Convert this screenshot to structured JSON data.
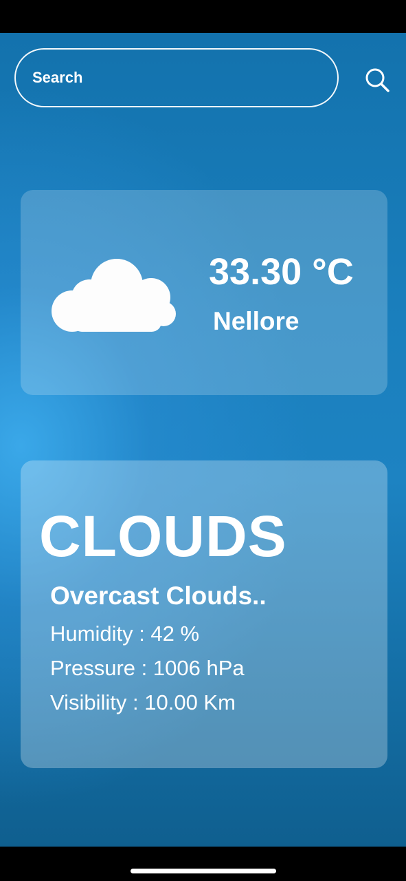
{
  "search": {
    "placeholder": "Search",
    "icon": "search-icon"
  },
  "current": {
    "icon": "cloud-icon",
    "temperature": "33.30 °C",
    "city": "Nellore"
  },
  "details": {
    "condition": "CLOUDS",
    "description": "Overcast Clouds..",
    "humidity": "Humidity : 42 %",
    "pressure": "Pressure : 1006 hPa",
    "visibility": "Visibility : 10.00 Km"
  },
  "colors": {
    "background_top": "#1372ad",
    "background_mid": "#1d83c2",
    "background_glow": "#3caaeb",
    "card_overlay": "rgba(255,255,255,0.2)",
    "text": "#ffffff"
  }
}
